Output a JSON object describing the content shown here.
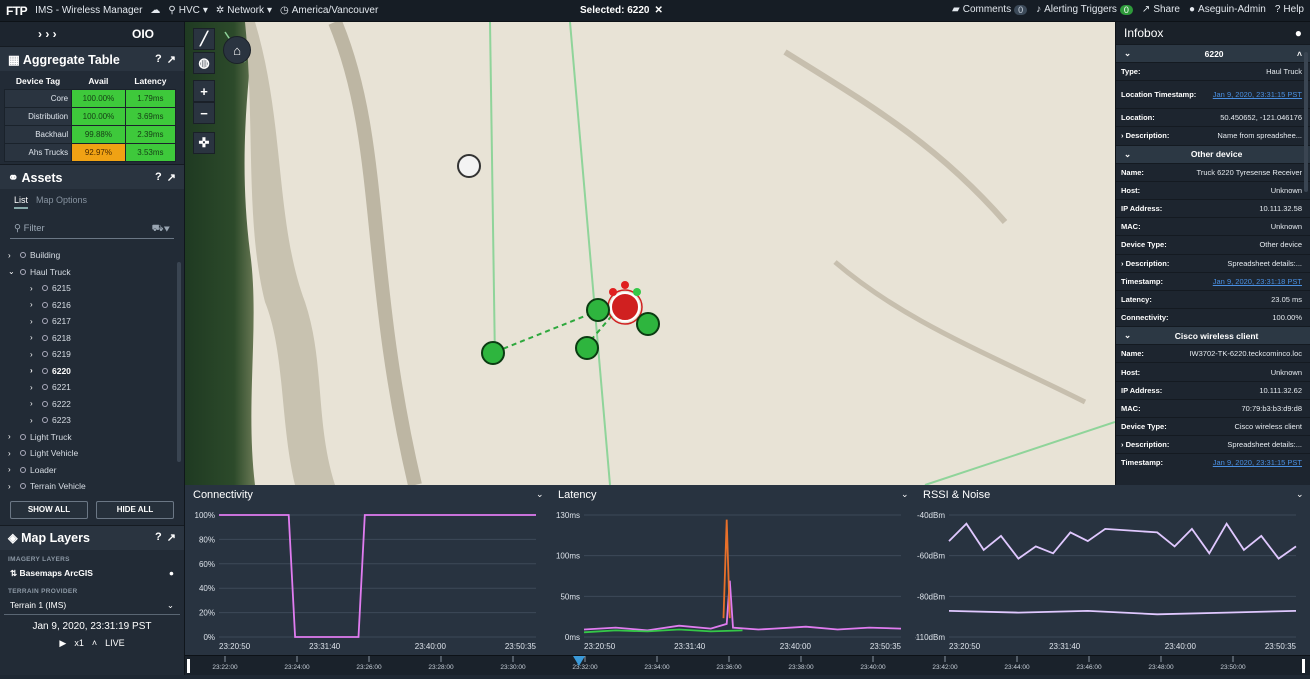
{
  "topbar": {
    "logo": "FTP",
    "app_title": "IMS - Wireless Manager",
    "site": "HVC",
    "network": "Network",
    "timezone": "America/Vancouver",
    "selected": "Selected: 6220",
    "comments": "Comments",
    "comments_count": "0",
    "alerting": "Alerting Triggers",
    "alerting_count": "0",
    "share": "Share",
    "user": "Aseguin-Admin",
    "help": "Help"
  },
  "left_header": {
    "expand": "› › ›",
    "toggle": "OIO"
  },
  "aggregate": {
    "title": "Aggregate Table",
    "columns": [
      "Device Tag",
      "Avail",
      "Latency"
    ],
    "rows": [
      {
        "tag": "Core",
        "avail": "100.00%",
        "latency": "1.79ms",
        "avail_status": "g"
      },
      {
        "tag": "Distribution",
        "avail": "100.00%",
        "latency": "3.69ms",
        "avail_status": "g"
      },
      {
        "tag": "Backhaul",
        "avail": "99.88%",
        "latency": "2.39ms",
        "avail_status": "g"
      },
      {
        "tag": "Ahs Trucks",
        "avail": "92.97%",
        "latency": "3.53ms",
        "avail_status": "y"
      }
    ]
  },
  "assets": {
    "title": "Assets",
    "tab_list": "List",
    "tab_map": "Map Options",
    "filter_placeholder": "Filter",
    "tree": [
      {
        "label": "Building",
        "level": 0,
        "open": false,
        "bold": false
      },
      {
        "label": "Haul Truck",
        "level": 0,
        "open": true,
        "bold": false
      },
      {
        "label": "6215",
        "level": 1,
        "open": false,
        "bold": false
      },
      {
        "label": "6216",
        "level": 1,
        "open": false,
        "bold": false
      },
      {
        "label": "6217",
        "level": 1,
        "open": false,
        "bold": false
      },
      {
        "label": "6218",
        "level": 1,
        "open": false,
        "bold": false
      },
      {
        "label": "6219",
        "level": 1,
        "open": false,
        "bold": false
      },
      {
        "label": "6220",
        "level": 1,
        "open": false,
        "bold": true
      },
      {
        "label": "6221",
        "level": 1,
        "open": false,
        "bold": false
      },
      {
        "label": "6222",
        "level": 1,
        "open": false,
        "bold": false
      },
      {
        "label": "6223",
        "level": 1,
        "open": false,
        "bold": false
      },
      {
        "label": "Light Truck",
        "level": 0,
        "open": false,
        "bold": false
      },
      {
        "label": "Light Vehicle",
        "level": 0,
        "open": false,
        "bold": false
      },
      {
        "label": "Loader",
        "level": 0,
        "open": false,
        "bold": false
      },
      {
        "label": "Terrain Vehicle",
        "level": 0,
        "open": false,
        "bold": false
      }
    ],
    "show_all": "SHOW ALL",
    "hide_all": "HIDE ALL"
  },
  "map_layers": {
    "title": "Map Layers",
    "imagery_label": "IMAGERY LAYERS",
    "imagery_value": "Basemaps ArcGIS",
    "terrain_label": "TERRAIN PROVIDER",
    "terrain_value": "Terrain 1 (IMS)"
  },
  "playback": {
    "time": "Jan 9, 2020, 23:31:19 PST",
    "speed": "x1",
    "mode": "LIVE"
  },
  "infobox": {
    "title": "Infobox",
    "device_id": "6220",
    "rows_main": [
      {
        "k": "Type:",
        "v": "Haul Truck",
        "link": false
      },
      {
        "k": "Location Timestamp:",
        "v": "Jan 9, 2020, 23:31:15 PST",
        "link": true,
        "tall": true
      },
      {
        "k": "Location:",
        "v": "50.450652, -121.046176",
        "link": false
      },
      {
        "k": "Description:",
        "v": "Name from spreadshee...",
        "link": false,
        "chev": true
      }
    ],
    "other_title": "Other device",
    "rows_other": [
      {
        "k": "Name:",
        "v": "Truck 6220 Tyresense Receiver",
        "link": false
      },
      {
        "k": "Host:",
        "v": "Unknown",
        "link": false
      },
      {
        "k": "IP Address:",
        "v": "10.111.32.58",
        "link": false
      },
      {
        "k": "MAC:",
        "v": "Unknown",
        "link": false
      },
      {
        "k": "Device Type:",
        "v": "Other device",
        "link": false
      },
      {
        "k": "Description:",
        "v": "Spreadsheet details:...",
        "link": false,
        "chev": true
      },
      {
        "k": "Timestamp:",
        "v": "Jan 9, 2020, 23:31:18 PST",
        "link": true
      },
      {
        "k": "Latency:",
        "v": "23.05 ms",
        "link": false
      },
      {
        "k": "Connectivity:",
        "v": "100.00%",
        "link": false
      }
    ],
    "cisco_title": "Cisco wireless client",
    "rows_cisco": [
      {
        "k": "Name:",
        "v": "IW3702-TK-6220.teckcominco.loc",
        "link": false
      },
      {
        "k": "Host:",
        "v": "Unknown",
        "link": false
      },
      {
        "k": "IP Address:",
        "v": "10.111.32.62",
        "link": false
      },
      {
        "k": "MAC:",
        "v": "70:79:b3:b3:d9:d8",
        "link": false
      },
      {
        "k": "Device Type:",
        "v": "Cisco wireless client",
        "link": false
      },
      {
        "k": "Description:",
        "v": "Spreadsheet details:...",
        "link": false,
        "chev": true
      },
      {
        "k": "Timestamp:",
        "v": "Jan 9, 2020, 23:31:15 PST",
        "link": true
      }
    ]
  },
  "chart_data": [
    {
      "type": "line",
      "title": "Connectivity",
      "y_ticks": [
        "100%",
        "80%",
        "60%",
        "40%",
        "20%",
        "0%"
      ],
      "x_ticks": [
        "23:20:50",
        "23:31:40",
        "23:40:00",
        "23:50:35"
      ],
      "ylim": [
        0,
        100
      ],
      "series": [
        {
          "color": "#e07cf0",
          "x": [
            0,
            0.22,
            0.24,
            0.26,
            0.42,
            0.44,
            0.46,
            1.0
          ],
          "y": [
            100,
            100,
            0,
            0,
            0,
            0,
            100,
            100
          ]
        }
      ]
    },
    {
      "type": "line",
      "title": "Latency",
      "y_ticks": [
        "130ms",
        "100ms",
        "50ms",
        "0ms"
      ],
      "x_ticks": [
        "23:20:50",
        "23:31:40",
        "23:40:00",
        "23:50:35"
      ],
      "ylim": [
        0,
        130
      ],
      "series": [
        {
          "color": "#e07cf0",
          "x": [
            0,
            0.1,
            0.2,
            0.3,
            0.4,
            0.45,
            0.46,
            0.47,
            0.55,
            0.6,
            0.7,
            0.8,
            0.9,
            1.0
          ],
          "y": [
            8,
            10,
            7,
            12,
            9,
            14,
            60,
            10,
            8,
            9,
            11,
            8,
            10,
            9
          ]
        },
        {
          "color": "#e8702a",
          "x": [
            0.44,
            0.45,
            0.46
          ],
          "y": [
            20,
            125,
            20
          ]
        },
        {
          "color": "#35c748",
          "x": [
            0,
            0.1,
            0.2,
            0.3,
            0.4,
            0.5
          ],
          "y": [
            5,
            7,
            6,
            8,
            6,
            7
          ]
        }
      ]
    },
    {
      "type": "line",
      "title": "RSSI & Noise",
      "y_ticks": [
        "-40dBm",
        "-60dBm",
        "-80dBm",
        "-110dBm"
      ],
      "x_ticks": [
        "23:20:50",
        "23:31:40",
        "23:40:00",
        "23:50:35"
      ],
      "ylim": [
        -110,
        -40
      ],
      "series": [
        {
          "color": "#e0c8ff",
          "x": [
            0,
            0.05,
            0.1,
            0.15,
            0.2,
            0.25,
            0.3,
            0.35,
            0.4,
            0.45,
            0.6,
            0.65,
            0.7,
            0.75,
            0.8,
            0.85,
            0.9,
            0.95,
            1.0
          ],
          "y": [
            -55,
            -45,
            -60,
            -52,
            -65,
            -58,
            -62,
            -50,
            -55,
            -48,
            -50,
            -58,
            -48,
            -62,
            -45,
            -60,
            -52,
            -65,
            -58
          ]
        },
        {
          "color": "#e0c8ff",
          "x": [
            0,
            0.2,
            0.4,
            0.6,
            0.8,
            1.0
          ],
          "y": [
            -95,
            -96,
            -95,
            -97,
            -96,
            -95
          ]
        }
      ]
    }
  ],
  "timeline": {
    "ticks": [
      "23:22:00",
      "23:24:00",
      "23:26:00",
      "23:28:00",
      "23:30:00",
      "23:32:00",
      "23:34:00",
      "23:36:00",
      "23:38:00",
      "23:40:00",
      "23:42:00",
      "23:44:00",
      "23:46:00",
      "23:48:00",
      "23:50:00"
    ]
  }
}
